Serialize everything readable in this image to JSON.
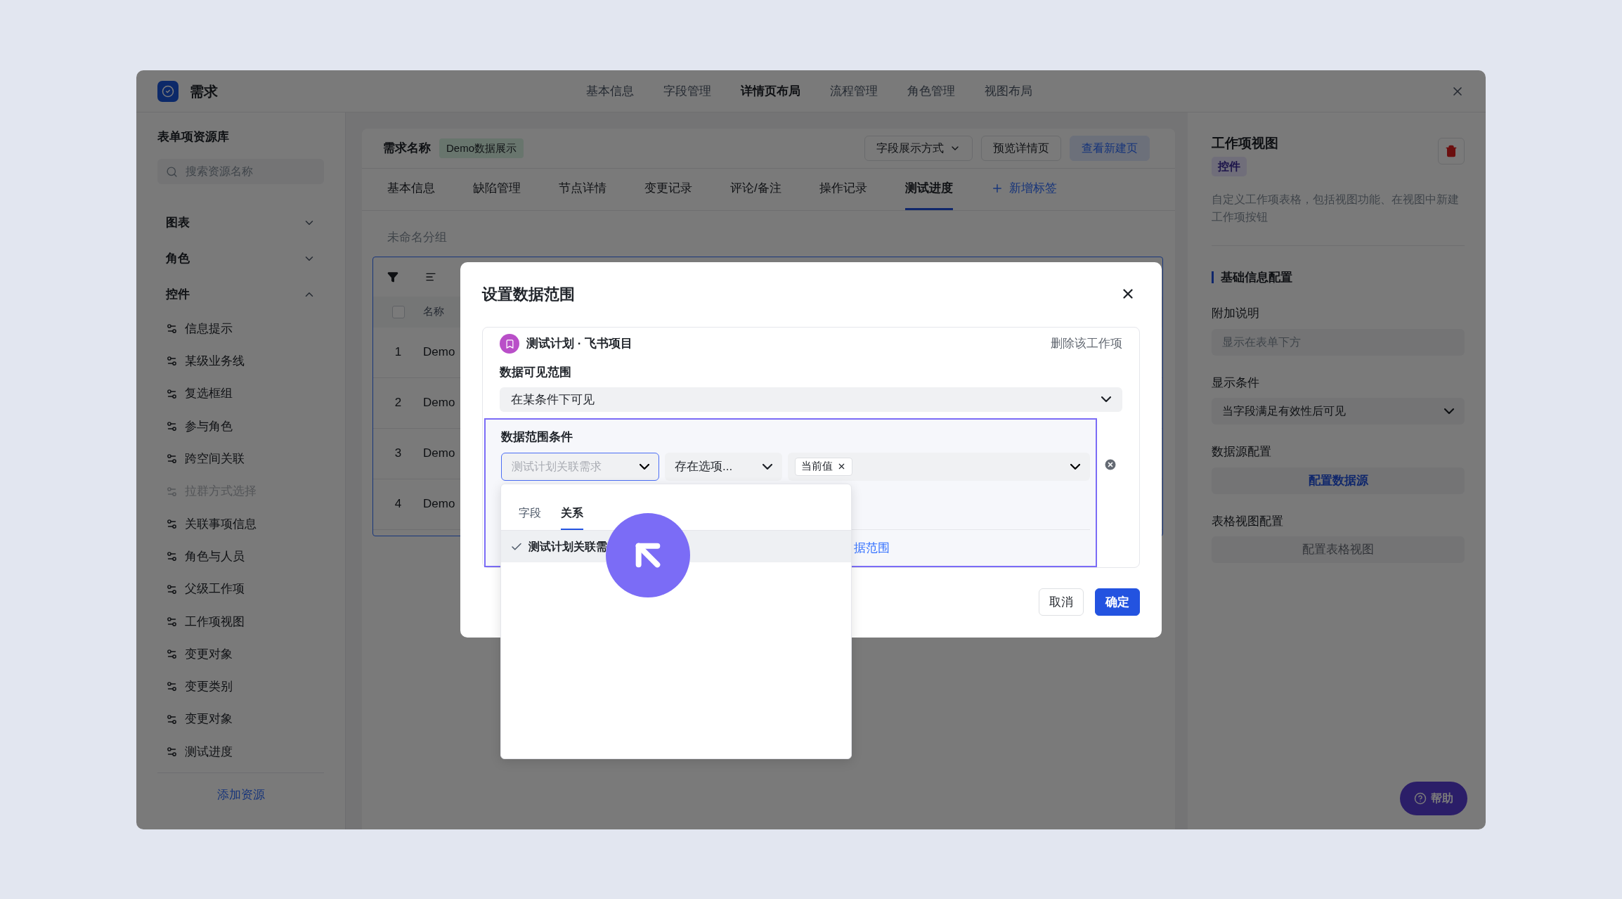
{
  "window": {
    "title": "需求"
  },
  "nav_tabs": [
    {
      "label": "基本信息",
      "selected": false
    },
    {
      "label": "字段管理",
      "selected": false
    },
    {
      "label": "详情页布局",
      "selected": true
    },
    {
      "label": "流程管理",
      "selected": false
    },
    {
      "label": "角色管理",
      "selected": false
    },
    {
      "label": "视图布局",
      "selected": false
    }
  ],
  "sidebar": {
    "title": "表单项资源库",
    "search": {
      "placeholder": "搜索资源名称"
    },
    "groups": [
      {
        "label": "图表",
        "expanded": false
      },
      {
        "label": "角色",
        "expanded": false
      },
      {
        "label": "控件",
        "expanded": true,
        "children": [
          {
            "label": "信息提示",
            "disabled": false
          },
          {
            "label": "某级业务线",
            "disabled": false
          },
          {
            "label": "复选框组",
            "disabled": false
          },
          {
            "label": "参与角色",
            "disabled": false
          },
          {
            "label": "跨空间关联",
            "disabled": false
          },
          {
            "label": "拉群方式选择",
            "disabled": true
          },
          {
            "label": "关联事项信息",
            "disabled": false
          },
          {
            "label": "角色与人员",
            "disabled": false
          },
          {
            "label": "父级工作项",
            "disabled": false
          },
          {
            "label": "工作项视图",
            "disabled": false
          },
          {
            "label": "变更对象",
            "disabled": false
          },
          {
            "label": "变更类别",
            "disabled": false
          },
          {
            "label": "变更对象",
            "disabled": false
          },
          {
            "label": "测试进度",
            "disabled": false
          }
        ]
      }
    ],
    "add_link": "添加资源"
  },
  "editor": {
    "name_label": "需求名称",
    "name_tag": "Demo数据展示",
    "buttons": [
      {
        "label": "字段展示方式",
        "kind": "dropdown"
      },
      {
        "label": "预览详情页",
        "kind": "plain"
      },
      {
        "label": "查看新建页",
        "kind": "primary"
      }
    ],
    "tabs": [
      {
        "label": "基本信息",
        "selected": false
      },
      {
        "label": "缺陷管理",
        "selected": false
      },
      {
        "label": "节点详情",
        "selected": false
      },
      {
        "label": "变更记录",
        "selected": false
      },
      {
        "label": "评论/备注",
        "selected": false
      },
      {
        "label": "操作记录",
        "selected": false
      },
      {
        "label": "测试进度",
        "selected": true
      }
    ],
    "add_tab": "新增标签",
    "group_title": "未命名分组",
    "table": {
      "header_checkbox": {
        "checked": false
      },
      "columns": [
        "名称"
      ],
      "rows": [
        {
          "index": "1",
          "name": "Demo"
        },
        {
          "index": "2",
          "name": "Demo"
        },
        {
          "index": "3",
          "name": "Demo"
        },
        {
          "index": "4",
          "name": "Demo"
        }
      ]
    }
  },
  "properties": {
    "title": "工作项视图",
    "tag": "控件",
    "description": "自定义工作项表格，包括视图功能、在视图中新建工作项按钮",
    "section": "基础信息配置",
    "fields": [
      {
        "kind": "input",
        "label": "附加说明",
        "placeholder": "显示在表单下方"
      },
      {
        "kind": "select",
        "label": "显示条件",
        "value": "当字段满足有效性后可见"
      },
      {
        "kind": "button",
        "label": "数据源配置",
        "button": "配置数据源",
        "disabled": false
      },
      {
        "kind": "button",
        "label": "表格视图配置",
        "button": "配置表格视图",
        "disabled": true
      }
    ]
  },
  "help_button": "帮助",
  "dialog": {
    "title": "设置数据范围",
    "item": {
      "title": "测试计划 · 飞书项目",
      "delete": "删除该工作项",
      "visibility_label": "数据可见范围",
      "visibility_value": "在某条件下可见",
      "condition_label": "数据范围条件",
      "condition": {
        "field_placeholder": "测试计划关联需求",
        "operator": "存在选项...",
        "value_tags": [
          "当前值"
        ]
      },
      "add_link": "据范围"
    },
    "dropdown": {
      "tabs": [
        {
          "label": "字段",
          "selected": false
        },
        {
          "label": "关系",
          "selected": true
        }
      ],
      "options": [
        {
          "label": "测试计划关联需",
          "checked": true
        }
      ]
    },
    "buttons": [
      {
        "label": "取消",
        "kind": "secondary"
      },
      {
        "label": "确定",
        "kind": "primary"
      }
    ]
  }
}
